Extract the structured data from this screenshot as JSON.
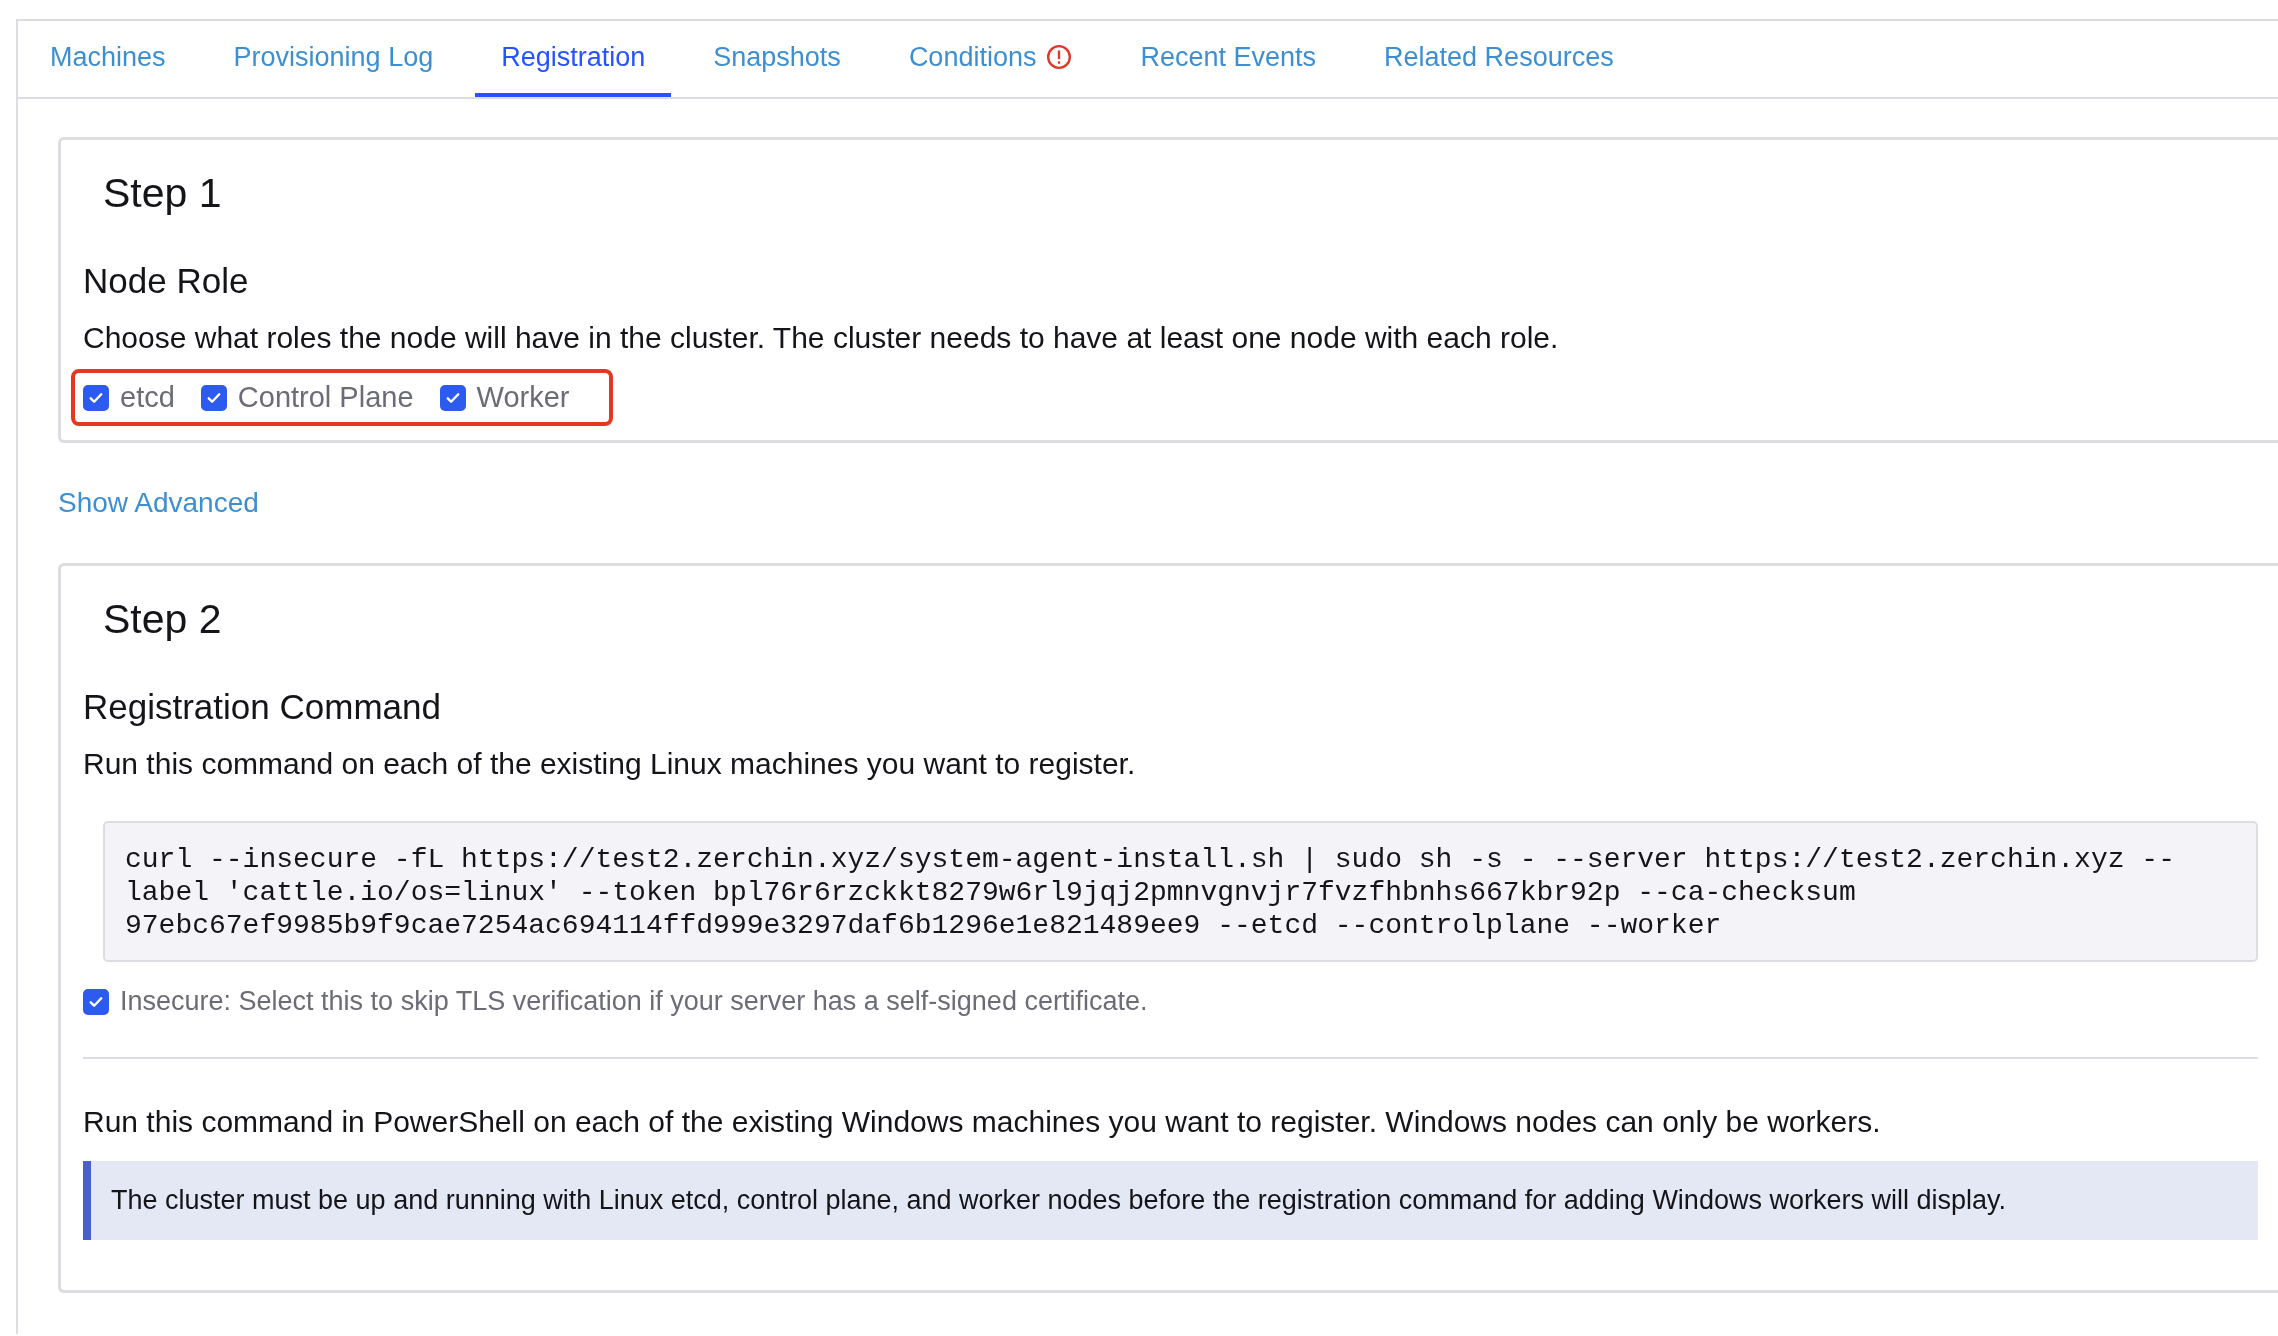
{
  "tabs": [
    {
      "label": "Machines",
      "selected": false,
      "alert": false
    },
    {
      "label": "Provisioning Log",
      "selected": false,
      "alert": false
    },
    {
      "label": "Registration",
      "selected": true,
      "alert": false
    },
    {
      "label": "Snapshots",
      "selected": false,
      "alert": false
    },
    {
      "label": "Conditions",
      "selected": false,
      "alert": true
    },
    {
      "label": "Recent Events",
      "selected": false,
      "alert": false
    },
    {
      "label": "Related Resources",
      "selected": false,
      "alert": false
    }
  ],
  "step1": {
    "title": "Step 1",
    "heading": "Node Role",
    "description": "Choose what roles the node will have in the cluster. The cluster needs to have at least one node with each role.",
    "roles": [
      {
        "label": "etcd",
        "checked": true
      },
      {
        "label": "Control Plane",
        "checked": true
      },
      {
        "label": "Worker",
        "checked": true
      }
    ]
  },
  "show_advanced": "Show Advanced",
  "step2": {
    "title": "Step 2",
    "heading": "Registration Command",
    "description": "Run this command on each of the existing Linux machines you want to register.",
    "command_lines": [
      "curl --insecure -fL https://test2.zerchin.xyz/system-agent-install.sh | sudo sh -s - --server https://test2.zerchin.xyz --",
      "label 'cattle.io/os=linux' --token bpl76r6rzckkt8279w6rl9jqj2pmnvgnvjr7fvzfhbnhs667kbr92p --ca-checksum",
      "97ebc67ef9985b9f9cae7254ac694114ffd999e3297daf6b1296e1e821489ee9 --etcd --controlplane --worker"
    ],
    "insecure": {
      "label": "Insecure: Select this to skip TLS verification if your server has a self-signed certificate.",
      "checked": true
    },
    "windows_description": "Run this command in PowerShell on each of the existing Windows machines you want to register. Windows nodes can only be workers.",
    "banner": "The cluster must be up and running with Linux etcd, control plane, and worker nodes before the registration command for adding Windows workers will display."
  }
}
